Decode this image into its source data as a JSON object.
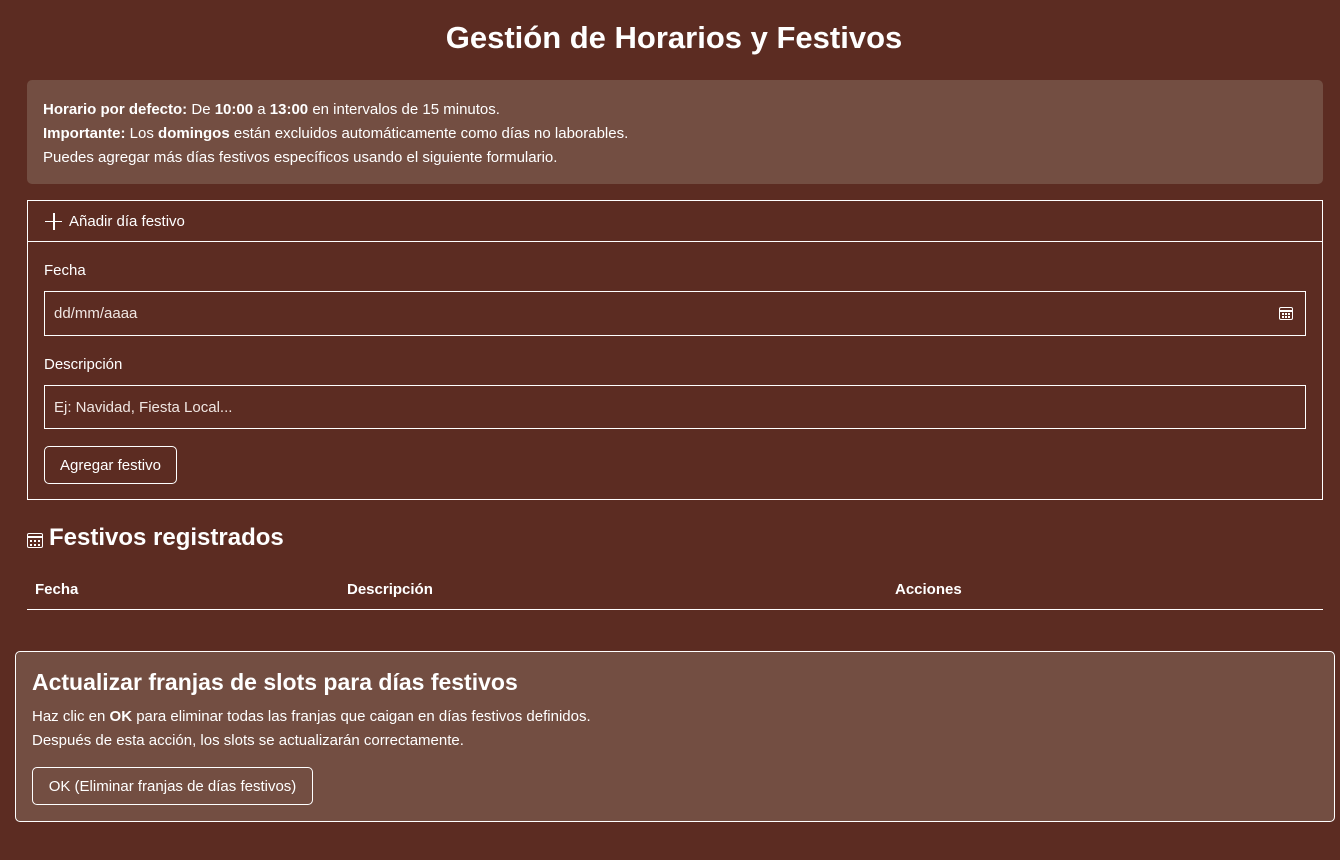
{
  "page": {
    "title": "Gestión de Horarios y Festivos"
  },
  "info": {
    "line1_label": "Horario por defecto:",
    "line1_pre": "De",
    "line1_start": "10:00",
    "line1_mid": "a",
    "line1_end": "13:00",
    "line1_post": "en intervalos de 15 minutos.",
    "line2_label": "Importante:",
    "line2_pre": "Los",
    "line2_bold": "domingos",
    "line2_post": "están excluidos automáticamente como días no laborables.",
    "line3": "Puedes agregar más días festivos específicos usando el siguiente formulario."
  },
  "form": {
    "header": "Añadir día festivo",
    "header_icon": "plus-icon",
    "date_label": "Fecha",
    "date_placeholder": "dd/mm/aaaa",
    "date_icon": "calendar-icon",
    "desc_label": "Descripción",
    "desc_placeholder": "Ej: Navidad, Fiesta Local...",
    "submit_label": "Agregar festivo"
  },
  "holidays": {
    "title": "Festivos registrados",
    "title_icon": "calendar-icon",
    "columns": [
      "Fecha",
      "Descripción",
      "Acciones"
    ],
    "rows": []
  },
  "update": {
    "title": "Actualizar franjas de slots para días festivos",
    "line1_pre": "Haz clic en",
    "line1_bold": "OK",
    "line1_post": "para eliminar todas las franjas que caigan en días festivos definidos.",
    "line2": "Después de esta acción, los slots se actualizarán correctamente.",
    "button_label": "OK (Eliminar franjas de días festivos)"
  },
  "colors": {
    "background": "#5c2c22",
    "panel": "#734e42",
    "text": "#ffffff"
  }
}
